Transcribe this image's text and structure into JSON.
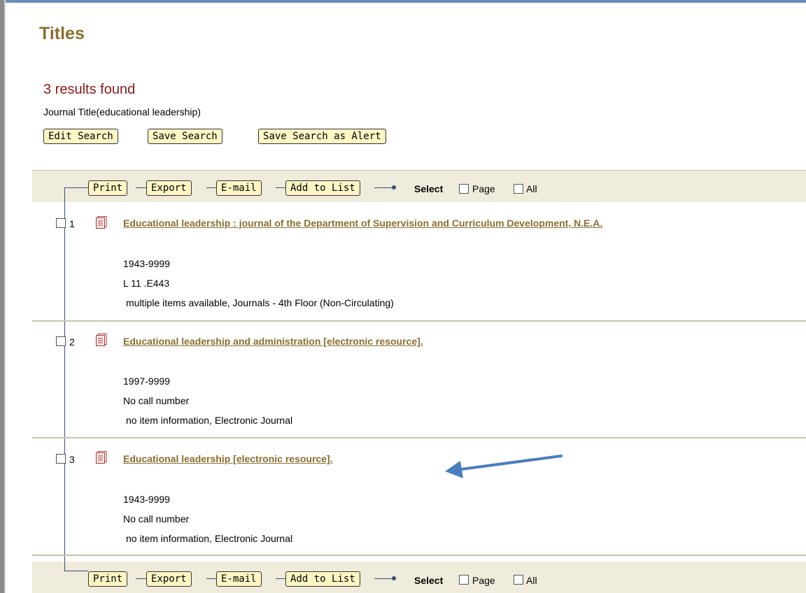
{
  "page": {
    "title": "Titles"
  },
  "results": {
    "count_text": "3 results found",
    "query_text": "Journal Title(educational leadership)"
  },
  "search_actions": {
    "edit": "Edit Search",
    "save": "Save Search",
    "alert": "Save Search as Alert"
  },
  "toolbar": {
    "print": "Print",
    "export": "Export",
    "email": "E-mail",
    "add_to_list": "Add to List",
    "select_label": "Select",
    "page_label": "Page",
    "all_label": "All"
  },
  "records": [
    {
      "number": "1",
      "title": "Educational leadership : journal of the Department of Supervision and Curriculum Development, N.E.A.",
      "dates": "1943-9999",
      "call_number": "L 11 .E443",
      "availability": "multiple items available, Journals - 4th Floor (Non-Circulating)"
    },
    {
      "number": "2",
      "title": "Educational leadership and administration [electronic resource].",
      "dates": "1997-9999",
      "call_number": "No call number",
      "availability": "no item information, Electronic Journal"
    },
    {
      "number": "3",
      "title": "Educational leadership [electronic resource].",
      "dates": "1943-9999",
      "call_number": "No call number",
      "availability": "no item information, Electronic Journal"
    }
  ],
  "colors": {
    "title": "#8a6e2f",
    "results_count": "#8b1a1a",
    "button_bg": "#fff6c4",
    "toolbar_bg": "#f0ecdc",
    "annotation_arrow": "#4a7cc0"
  },
  "icons": {
    "record_type": "document-icon",
    "annotation": "arrow-left-icon"
  }
}
